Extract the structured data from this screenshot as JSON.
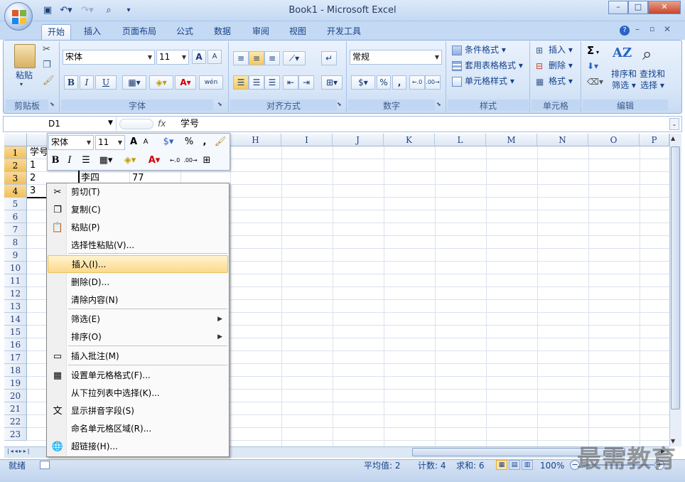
{
  "window": {
    "title": "Book1 - Microsoft Excel",
    "minimize": "–",
    "restore": "□",
    "close": "✕"
  },
  "ribbon_tabs": [
    {
      "label": "开始"
    },
    {
      "label": "插入"
    },
    {
      "label": "页面布局"
    },
    {
      "label": "公式"
    },
    {
      "label": "数据"
    },
    {
      "label": "审阅"
    },
    {
      "label": "视图"
    },
    {
      "label": "开发工具"
    }
  ],
  "ribbon": {
    "clipboard": {
      "label": "剪贴板",
      "paste": "粘贴"
    },
    "font": {
      "label": "字体",
      "font_name": "宋体",
      "font_size": "11",
      "grow": "A",
      "shrink": "A",
      "bold": "B",
      "italic": "I",
      "underline": "U",
      "wen": "wén"
    },
    "alignment": {
      "label": "对齐方式"
    },
    "number": {
      "label": "数字",
      "format": "常规",
      "percent": "%",
      "comma": ","
    },
    "styles": {
      "label": "样式",
      "conditional": "条件格式",
      "table": "套用表格格式",
      "cell": "单元格样式"
    },
    "cells": {
      "label": "单元格",
      "insert": "插入",
      "delete": "删除",
      "format": "格式"
    },
    "editing": {
      "label": "编辑",
      "sigma": "Σ",
      "sort_filter_1": "排序和",
      "sort_filter_2": "筛选",
      "find_1": "查找和",
      "find_2": "选择"
    }
  },
  "formula_bar": {
    "name_box": "D1",
    "fx": "fx",
    "formula": "学号"
  },
  "columns": [
    "H",
    "I",
    "J",
    "K",
    "L",
    "M",
    "N",
    "O",
    "P"
  ],
  "rows": [
    "1",
    "2",
    "3",
    "4",
    "5",
    "6",
    "7",
    "8",
    "9",
    "10",
    "11",
    "12",
    "13",
    "14",
    "15",
    "16",
    "17",
    "18",
    "19",
    "20",
    "21",
    "22",
    "23"
  ],
  "cells": {
    "a1": "学号",
    "a2": "1",
    "a3": "2",
    "a4": "3",
    "b3": "李四",
    "c3": "77"
  },
  "mini_toolbar": {
    "font": "宋体",
    "size": "11",
    "percent": "%",
    "comma": ",",
    "bold": "B",
    "italic": "I"
  },
  "context_menu": [
    {
      "label": "剪切(T)",
      "icon": "scissors-icon",
      "glyph": "✂"
    },
    {
      "label": "复制(C)",
      "icon": "copy-icon",
      "glyph": "❐"
    },
    {
      "label": "粘贴(P)",
      "icon": "paste-icon",
      "glyph": "📋"
    },
    {
      "label": "选择性粘贴(V)...",
      "icon": "",
      "glyph": ""
    },
    {
      "label": "插入(I)...",
      "icon": "",
      "glyph": ""
    },
    {
      "label": "删除(D)...",
      "icon": "",
      "glyph": ""
    },
    {
      "label": "清除内容(N)",
      "icon": "",
      "glyph": ""
    },
    {
      "label": "筛选(E)",
      "icon": "",
      "glyph": ""
    },
    {
      "label": "排序(O)",
      "icon": "",
      "glyph": ""
    },
    {
      "label": "插入批注(M)",
      "icon": "comment-icon",
      "glyph": "▭"
    },
    {
      "label": "设置单元格格式(F)...",
      "icon": "format-cells-icon",
      "glyph": "▦"
    },
    {
      "label": "从下拉列表中选择(K)...",
      "icon": "",
      "glyph": ""
    },
    {
      "label": "显示拼音字段(S)",
      "icon": "phonetic-icon",
      "glyph": "文"
    },
    {
      "label": "命名单元格区域(R)...",
      "icon": "",
      "glyph": ""
    },
    {
      "label": "超链接(H)...",
      "icon": "hyperlink-icon",
      "glyph": "🌐"
    }
  ],
  "status": {
    "ready": "就绪",
    "average": "平均值: 2",
    "count": "计数: 4",
    "sum": "求和: 6",
    "zoom": "100%"
  },
  "watermark": "最需教育"
}
